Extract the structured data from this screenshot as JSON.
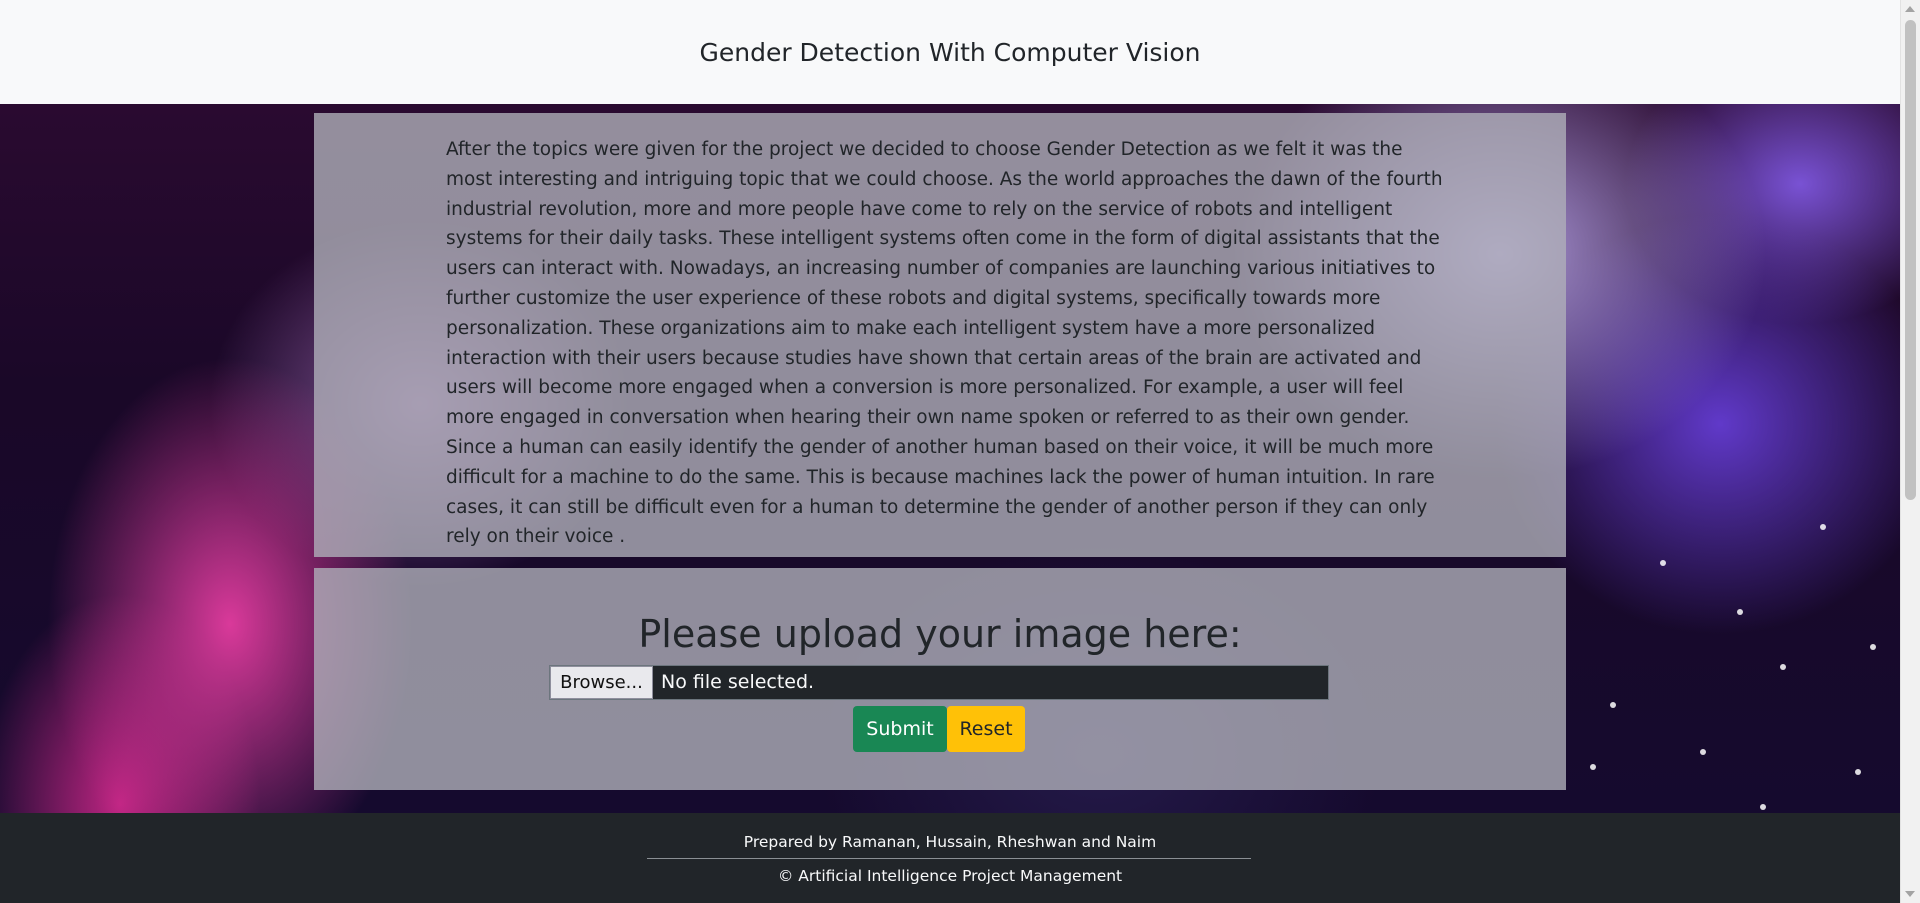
{
  "header": {
    "title": "Gender Detection With Computer Vision"
  },
  "about": {
    "text": "After the topics were given for the project we decided to choose Gender Detection as we felt it was the most interesting and intriguing topic that we could choose. As the world approaches the dawn of the fourth industrial revolution, more and more people have come to rely on the service of robots and intelligent systems for their daily tasks. These intelligent systems often come in the form of digital assistants that the users can interact with. Nowadays, an increasing number of companies are launching various initiatives to further customize the user experience of these robots and digital systems, specifically towards more personalization. These organizations aim to make each intelligent system have a more personalized interaction with their users because studies have shown that certain areas of the brain are activated and users will become more engaged when a conversion is more personalized. For example, a user will feel more engaged in conversation when hearing their own name spoken or referred to as their own gender. Since a human can easily identify the gender of another human based on their voice, it will be much more difficult for a machine to do the same. This is because machines lack the power of human intuition. In rare cases, it can still be difficult even for a human to determine the gender of another person if they can only rely on their voice ."
  },
  "upload": {
    "heading": "Please upload your image here:",
    "browse_label": "Browse...",
    "file_status": "No file selected.",
    "submit_label": "Submit",
    "reset_label": "Reset"
  },
  "footer": {
    "credits": "Prepared by Ramanan, Hussain, Rheshwan and Naim",
    "copyright": "© Artificial Intelligence Project Management"
  },
  "colors": {
    "navbar_bg": "#f8f9fa",
    "footer_bg": "#212529",
    "submit_bg": "#198754",
    "reset_bg": "#ffc107",
    "file_input_bg": "#212529"
  }
}
